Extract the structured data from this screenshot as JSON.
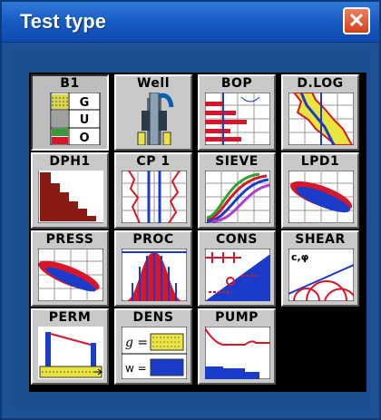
{
  "window": {
    "title": "Test type",
    "close_glyph": "✕"
  },
  "tiles": [
    {
      "label": "B1",
      "icon": "b1-soil-column-icon"
    },
    {
      "label": "Well",
      "icon": "well-icon"
    },
    {
      "label": "BOP",
      "icon": "bop-log-icon"
    },
    {
      "label": "D.LOG",
      "icon": "d-log-icon"
    },
    {
      "label": "DPH1",
      "icon": "dph1-staircase-icon"
    },
    {
      "label": "CP 1",
      "icon": "cp1-cone-penetration-icon"
    },
    {
      "label": "SIEVE",
      "icon": "sieve-curves-icon"
    },
    {
      "label": "LPD1",
      "icon": "lpd1-ellipse-icon"
    },
    {
      "label": "PRESS",
      "icon": "press-curve-icon"
    },
    {
      "label": "PROC",
      "icon": "proc-histogram-icon"
    },
    {
      "label": "CONS",
      "icon": "cons-consolidation-icon"
    },
    {
      "label": "SHEAR",
      "icon": "shear-mohr-icon"
    },
    {
      "label": "PERM",
      "icon": "perm-permeability-icon"
    },
    {
      "label": "DENS",
      "icon": "dens-density-icon"
    },
    {
      "label": "PUMP",
      "icon": "pump-test-icon"
    }
  ],
  "b1_letters": [
    "G",
    "U",
    "O"
  ],
  "dens_labels": [
    "g =",
    "w ="
  ],
  "shear_label": "c,φ",
  "colors": {
    "title_bar": "#1659c2",
    "close_button": "#d2431f",
    "background": "#1c4f8f",
    "tile": "#c9c9c9",
    "accent_red": "#d8162a",
    "accent_blue": "#1a3cc9",
    "accent_yellow": "#e9e53c"
  }
}
